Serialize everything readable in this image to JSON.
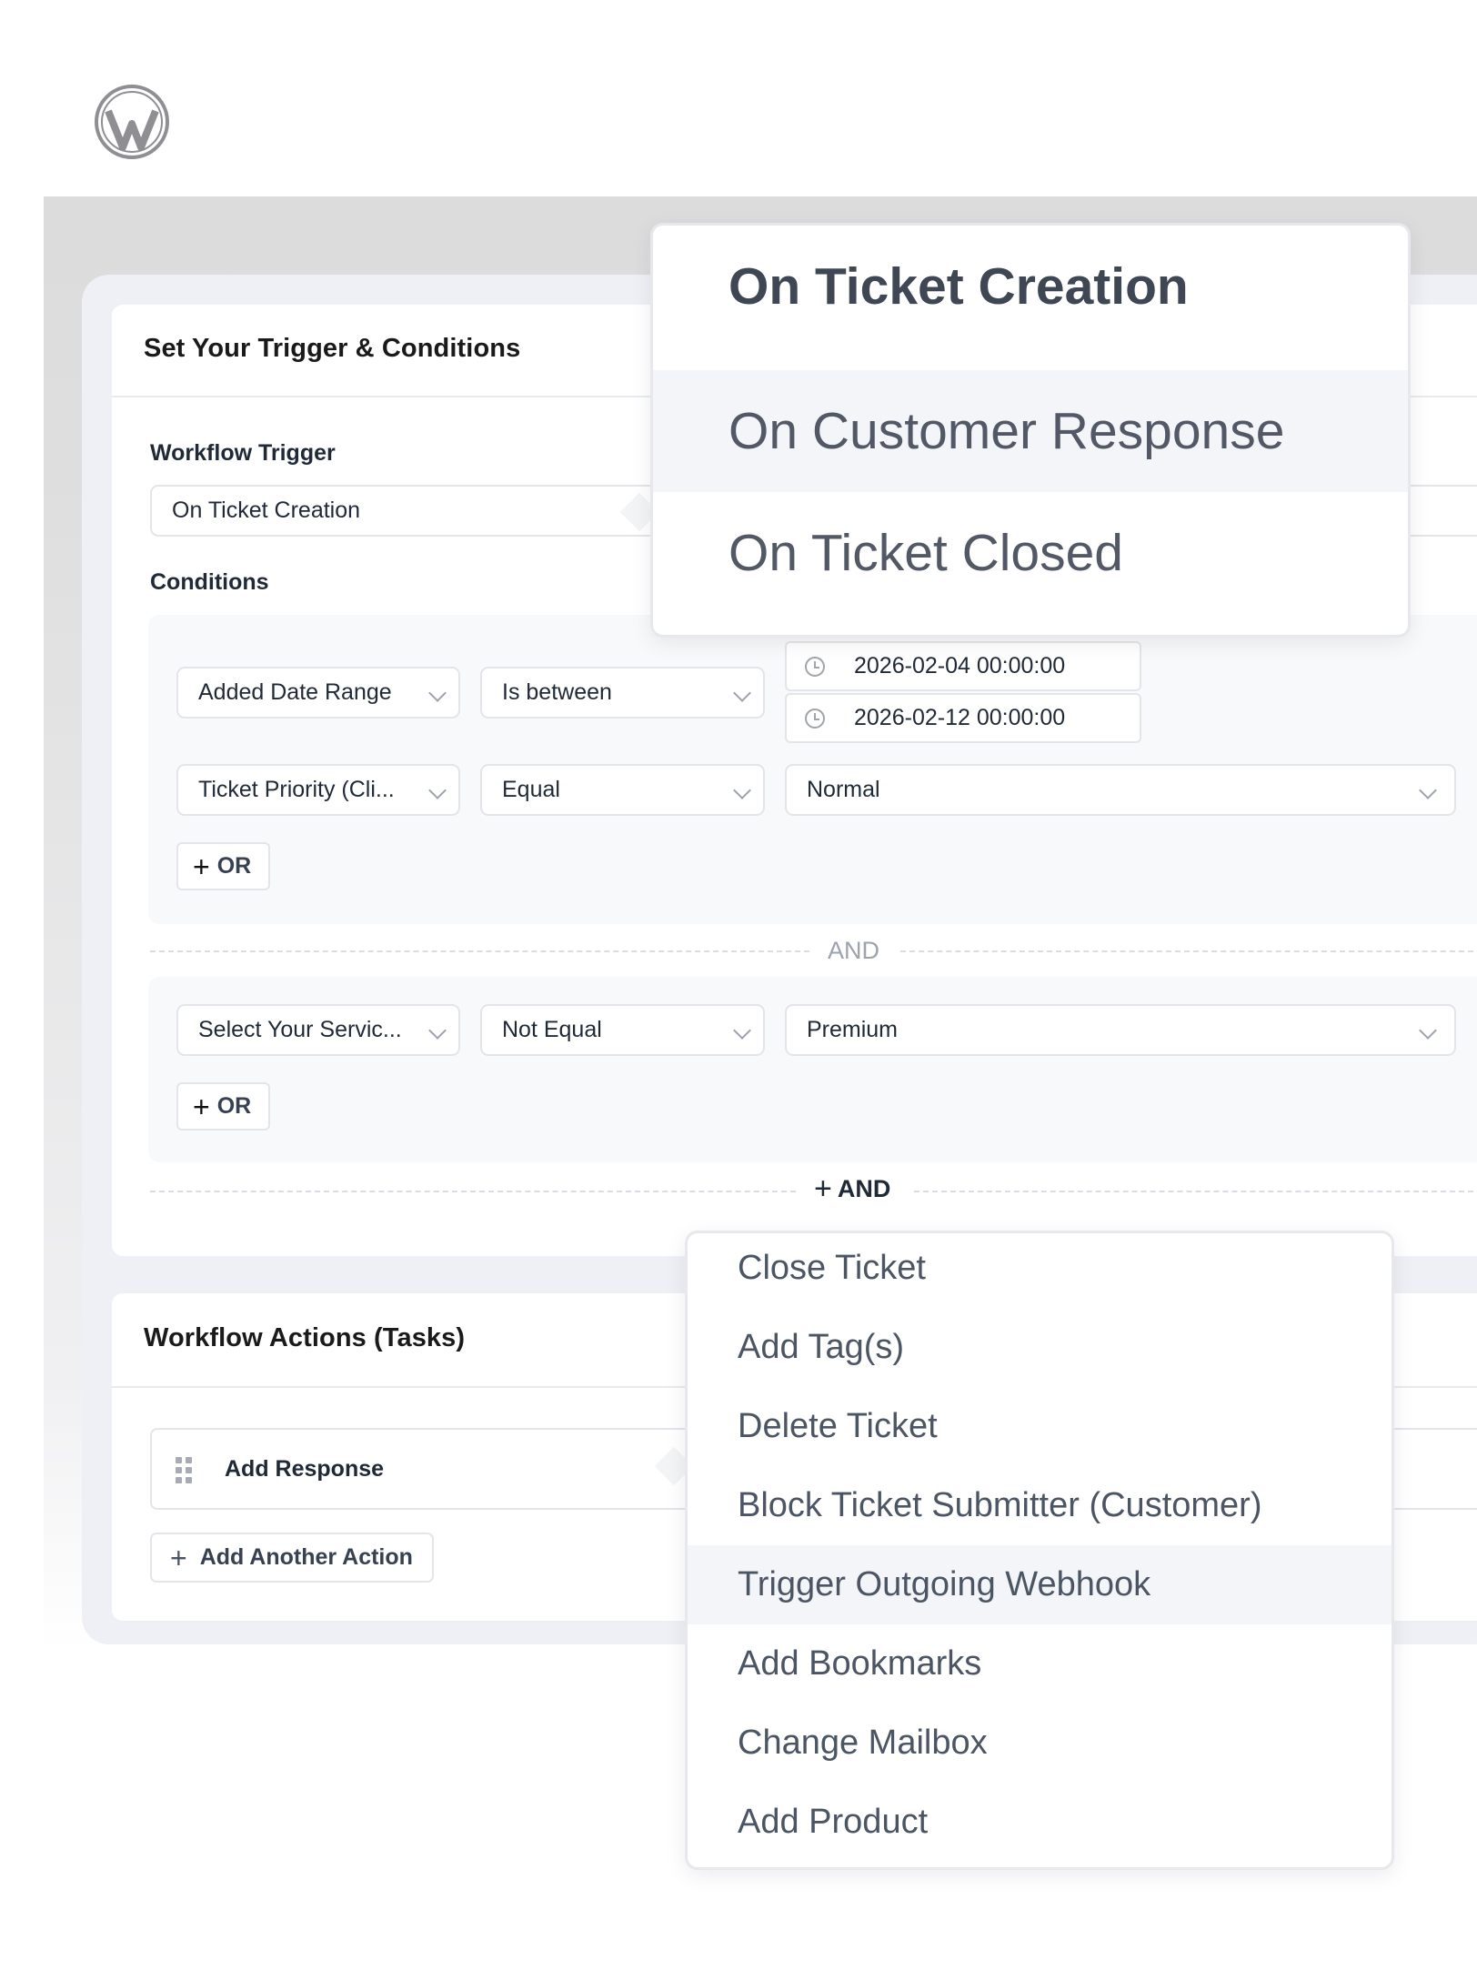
{
  "logo": "wordpress-logo",
  "trigger_panel": {
    "title": "Set Your Trigger & Conditions",
    "workflow_trigger_label": "Workflow Trigger",
    "workflow_trigger_value": "On Ticket Creation",
    "conditions_label": "Conditions"
  },
  "condition_groups": [
    {
      "rows": [
        {
          "field": "Added Date Range",
          "operator": "Is between",
          "date_from": "2026-02-04 00:00:00",
          "date_to": "2026-02-12 00:00:00"
        },
        {
          "field": "Ticket Priority (Cli...",
          "operator": "Equal",
          "value": "Normal"
        }
      ],
      "or_label": "OR"
    },
    {
      "rows": [
        {
          "field": "Select Your Servic...",
          "operator": "Not Equal",
          "value": "Premium"
        }
      ],
      "or_label": "OR"
    }
  ],
  "and_separator": "AND",
  "add_and_label": "AND",
  "actions_panel": {
    "title": "Workflow Actions (Tasks)",
    "action_item": "Add Response",
    "add_another_label": "Add Another Action"
  },
  "trigger_dropdown": {
    "options": [
      "On Ticket Creation",
      "On Customer Response",
      "On Ticket Closed"
    ],
    "selected": "On Ticket Creation",
    "hovered": "On Customer Response"
  },
  "action_dropdown": {
    "options": [
      "Close Ticket",
      "Add Tag(s)",
      "Delete Ticket",
      "Block Ticket Submitter (Customer)",
      "Trigger Outgoing Webhook",
      "Add Bookmarks",
      "Change Mailbox",
      "Add Product"
    ],
    "hovered": "Trigger Outgoing Webhook"
  }
}
